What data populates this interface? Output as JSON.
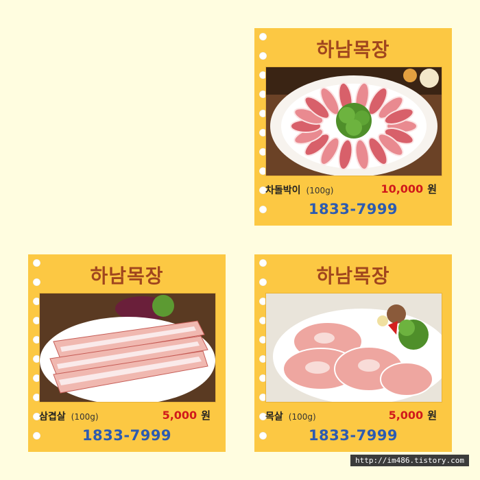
{
  "cards": [
    {
      "brand": "하남목장",
      "product": "차돌박이",
      "weight": "(100g)",
      "price": "10,000",
      "currency": "원",
      "phone": "1833-7999",
      "photo_subject": "sliced-brisket-plate"
    },
    {
      "brand": "하남목장",
      "product": "삼겹살",
      "weight": "(100g)",
      "price": "5,000",
      "currency": "원",
      "phone": "1833-7999",
      "photo_subject": "pork-belly-plate"
    },
    {
      "brand": "하남목장",
      "product": "목살",
      "weight": "(100g)",
      "price": "5,000",
      "currency": "원",
      "phone": "1833-7999",
      "photo_subject": "pork-neck-plate"
    }
  ],
  "watermark": "http://im486.tistory.com",
  "colors": {
    "background": "#fffde0",
    "card": "#fcc843",
    "title": "#a0461e",
    "price": "#d0191b",
    "phone": "#2d5bb0"
  }
}
